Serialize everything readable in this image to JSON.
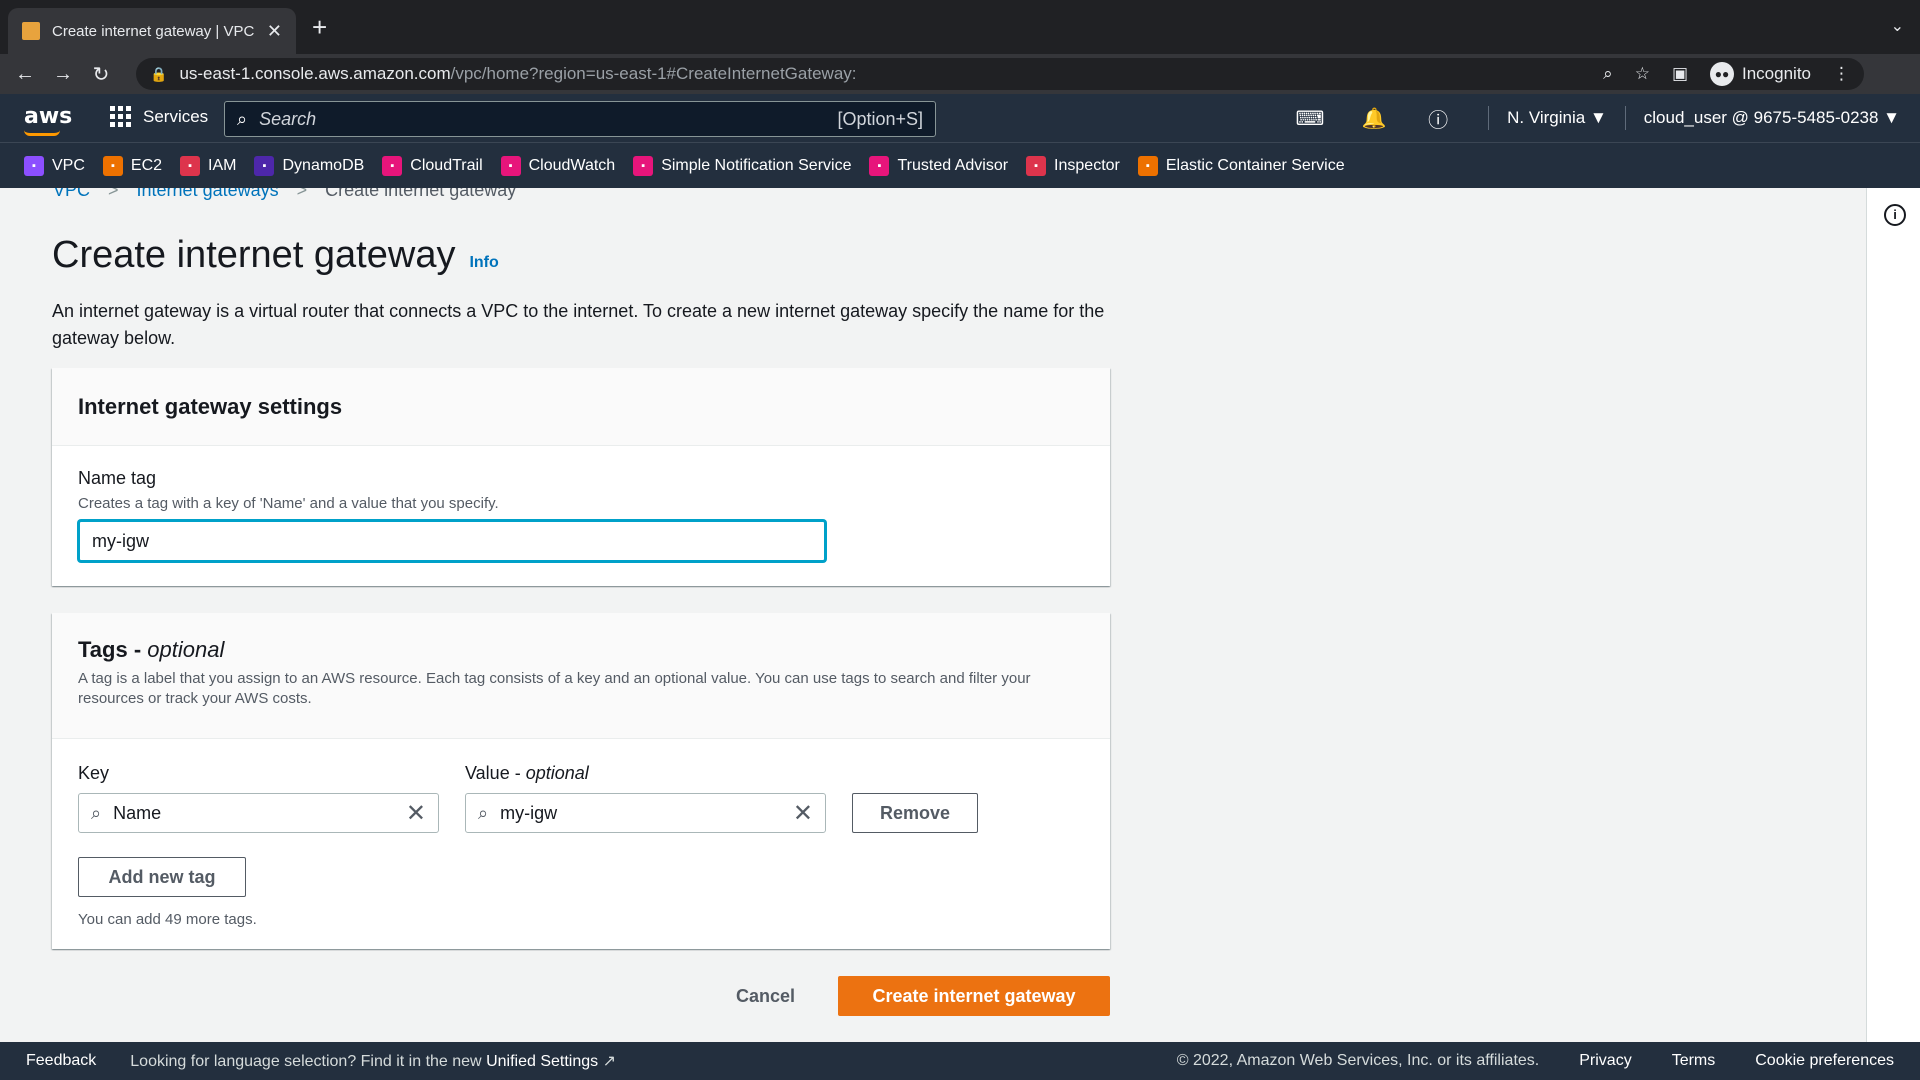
{
  "browser": {
    "tab_title": "Create internet gateway | VPC",
    "url_host": "us-east-1.console.aws.amazon.com",
    "url_path": "/vpc/home?region=us-east-1#CreateInternetGateway:",
    "incognito_label": "Incognito"
  },
  "aws_nav": {
    "services_label": "Services",
    "search_placeholder": "Search",
    "search_shortcut": "[Option+S]",
    "region": "N. Virginia",
    "account": "cloud_user @ 9675-5485-0238"
  },
  "favorites": [
    {
      "label": "VPC",
      "color": "#8c4fff"
    },
    {
      "label": "EC2",
      "color": "#ed7100"
    },
    {
      "label": "IAM",
      "color": "#dd344c"
    },
    {
      "label": "DynamoDB",
      "color": "#4d27aa"
    },
    {
      "label": "CloudTrail",
      "color": "#e7157b"
    },
    {
      "label": "CloudWatch",
      "color": "#e7157b"
    },
    {
      "label": "Simple Notification Service",
      "color": "#e7157b"
    },
    {
      "label": "Trusted Advisor",
      "color": "#e7157b"
    },
    {
      "label": "Inspector",
      "color": "#dd344c"
    },
    {
      "label": "Elastic Container Service",
      "color": "#ed7100"
    }
  ],
  "breadcrumb": {
    "items": [
      "VPC",
      "Internet gateways",
      "Create internet gateway"
    ]
  },
  "page": {
    "title": "Create internet gateway",
    "info_link": "Info",
    "description": "An internet gateway is a virtual router that connects a VPC to the internet. To create a new internet gateway specify the name for the gateway below."
  },
  "settings": {
    "heading": "Internet gateway settings",
    "name_label": "Name tag",
    "name_hint": "Creates a tag with a key of 'Name' and a value that you specify.",
    "name_value": "my-igw"
  },
  "tags": {
    "heading": "Tags - ",
    "heading_optional": "optional",
    "description": "A tag is a label that you assign to an AWS resource. Each tag consists of a key and an optional value. You can use tags to search and filter your resources or track your AWS costs.",
    "key_label": "Key",
    "value_label": "Value - ",
    "value_optional": "optional",
    "key_value": "Name",
    "value_value": "my-igw",
    "remove_label": "Remove",
    "add_label": "Add new tag",
    "limit_text": "You can add 49 more tags."
  },
  "actions": {
    "cancel_label": "Cancel",
    "create_label": "Create internet gateway"
  },
  "footer": {
    "feedback": "Feedback",
    "lang_text": "Looking for language selection? Find it in the new",
    "lang_link": "Unified Settings",
    "copyright": "© 2022, Amazon Web Services, Inc. or its affiliates.",
    "privacy": "Privacy",
    "terms": "Terms",
    "cookies": "Cookie preferences"
  }
}
